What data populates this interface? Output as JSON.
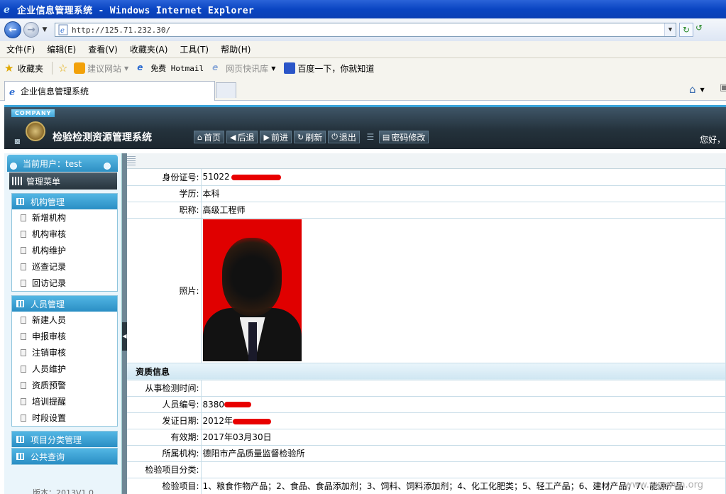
{
  "window": {
    "title": "企业信息管理系统 - Windows Internet Explorer",
    "address": "http://125.71.232.30/"
  },
  "menu": [
    "文件(F)",
    "编辑(E)",
    "查看(V)",
    "收藏夹(A)",
    "工具(T)",
    "帮助(H)"
  ],
  "favorites": {
    "label": "收藏夹",
    "items": [
      "建议网站",
      "免费 Hotmail",
      "网页快讯库",
      "百度一下，你就知道"
    ]
  },
  "tab": {
    "title": "企业信息管理系统"
  },
  "app": {
    "company_tag": "COMPANY",
    "title": "检验检测资源管理系统",
    "toolbar": [
      "首页",
      "后退",
      "前进",
      "刷新",
      "退出",
      "密码修改"
    ],
    "greeting": "您好，"
  },
  "sidebar": {
    "current_user": "当前用户：test",
    "menu_title": "管理菜单",
    "groups": [
      {
        "title": "机构管理",
        "items": [
          "新增机构",
          "机构审核",
          "机构维护",
          "巡查记录",
          "回访记录"
        ]
      },
      {
        "title": "人员管理",
        "items": [
          "新建人员",
          "申报审核",
          "注销审核",
          "人员维护",
          "资质预警",
          "培训提醒",
          "时段设置"
        ]
      },
      {
        "title": "项目分类管理",
        "items": []
      },
      {
        "title": "公共查询",
        "items": []
      }
    ],
    "version": "版本：2013V1.0"
  },
  "detail": {
    "id_label": "身份证号:",
    "id_value": "51022",
    "education_label": "学历:",
    "education_value": "本科",
    "title_label": "职称:",
    "title_value": "高级工程师",
    "photo_label": "照片:",
    "section_title": "资质信息",
    "work_time_label": "从事检测时间:",
    "work_time_value": "",
    "staff_no_label": "人员编号:",
    "staff_no_value": "8380",
    "issue_date_label": "发证日期:",
    "issue_date_value": "2012年",
    "valid_label": "有效期:",
    "valid_value": "2017年03月30日",
    "org_label": "所属机构:",
    "org_value": "德阳市产品质量监督检验所",
    "category_label": "检验项目分类:",
    "category_value": "",
    "items_label": "检验项目:",
    "items_value": "1、粮食作物产品；2、食品、食品添加剂；3、饲料、饲料添加剂；4、化工化肥类；5、轻工产品；6、建材产品；7、能源产品"
  },
  "watermark": "www.wooyun.org"
}
